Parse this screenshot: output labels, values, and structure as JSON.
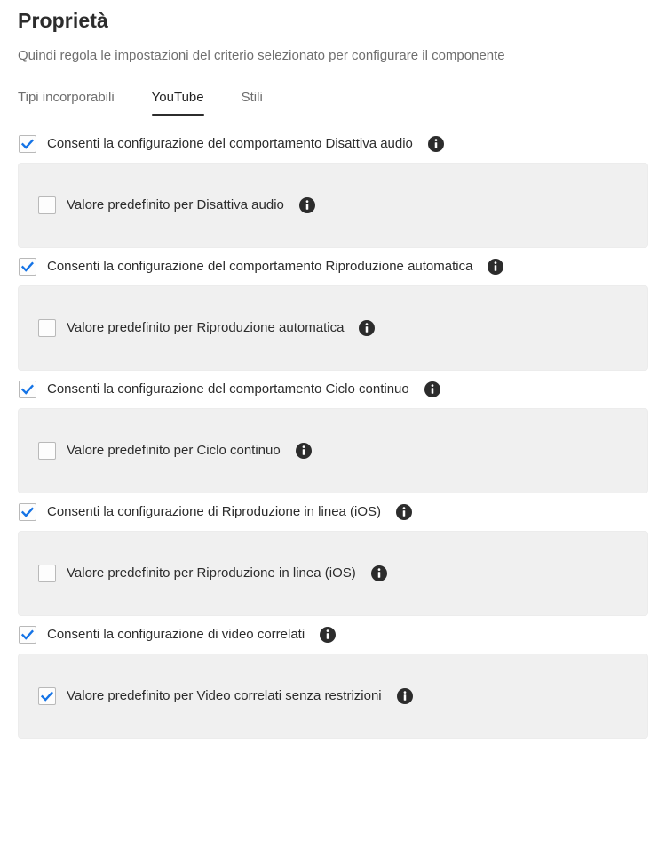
{
  "header": {
    "title": "Proprietà",
    "subtitle": "Quindi regola le impostazioni del criterio selezionato per configurare il componente"
  },
  "tabs": [
    {
      "label": "Tipi incorporabili",
      "active": false
    },
    {
      "label": "YouTube",
      "active": true
    },
    {
      "label": "Stili",
      "active": false
    }
  ],
  "colors": {
    "checkbox_accent": "#1473e6",
    "checkbox_border": "#b9b9b9",
    "panel_background": "#f0f0f0",
    "text_primary": "#2c2c2c",
    "text_secondary": "#6e6e6e",
    "info_icon": "#2c2c2c",
    "tab_underline": "#2c2c2c"
  },
  "icons": {
    "info": "info-circle-icon",
    "check": "checkmark-icon"
  },
  "groups": [
    {
      "toggle": {
        "label": "Consenti la configurazione del comportamento Disattiva audio",
        "checked": true,
        "info": "info-circle-icon"
      },
      "panel": {
        "label": "Valore predefinito per Disattiva audio",
        "checked": false,
        "info": "info-circle-icon"
      }
    },
    {
      "toggle": {
        "label": "Consenti la configurazione del comportamento Riproduzione automatica",
        "checked": true,
        "info": "info-circle-icon"
      },
      "panel": {
        "label": "Valore predefinito per Riproduzione automatica",
        "checked": false,
        "info": "info-circle-icon"
      }
    },
    {
      "toggle": {
        "label": "Consenti la configurazione del comportamento Ciclo continuo",
        "checked": true,
        "info": "info-circle-icon"
      },
      "panel": {
        "label": "Valore predefinito per Ciclo continuo",
        "checked": false,
        "info": "info-circle-icon"
      }
    },
    {
      "toggle": {
        "label": "Consenti la configurazione di Riproduzione in linea (iOS)",
        "checked": true,
        "info": "info-circle-icon"
      },
      "panel": {
        "label": "Valore predefinito per Riproduzione in linea (iOS)",
        "checked": false,
        "info": "info-circle-icon"
      }
    },
    {
      "toggle": {
        "label": "Consenti la configurazione di video correlati",
        "checked": true,
        "info": "info-circle-icon"
      },
      "panel": {
        "label": "Valore predefinito per Video correlati senza restrizioni",
        "checked": true,
        "info": "info-circle-icon"
      }
    }
  ]
}
